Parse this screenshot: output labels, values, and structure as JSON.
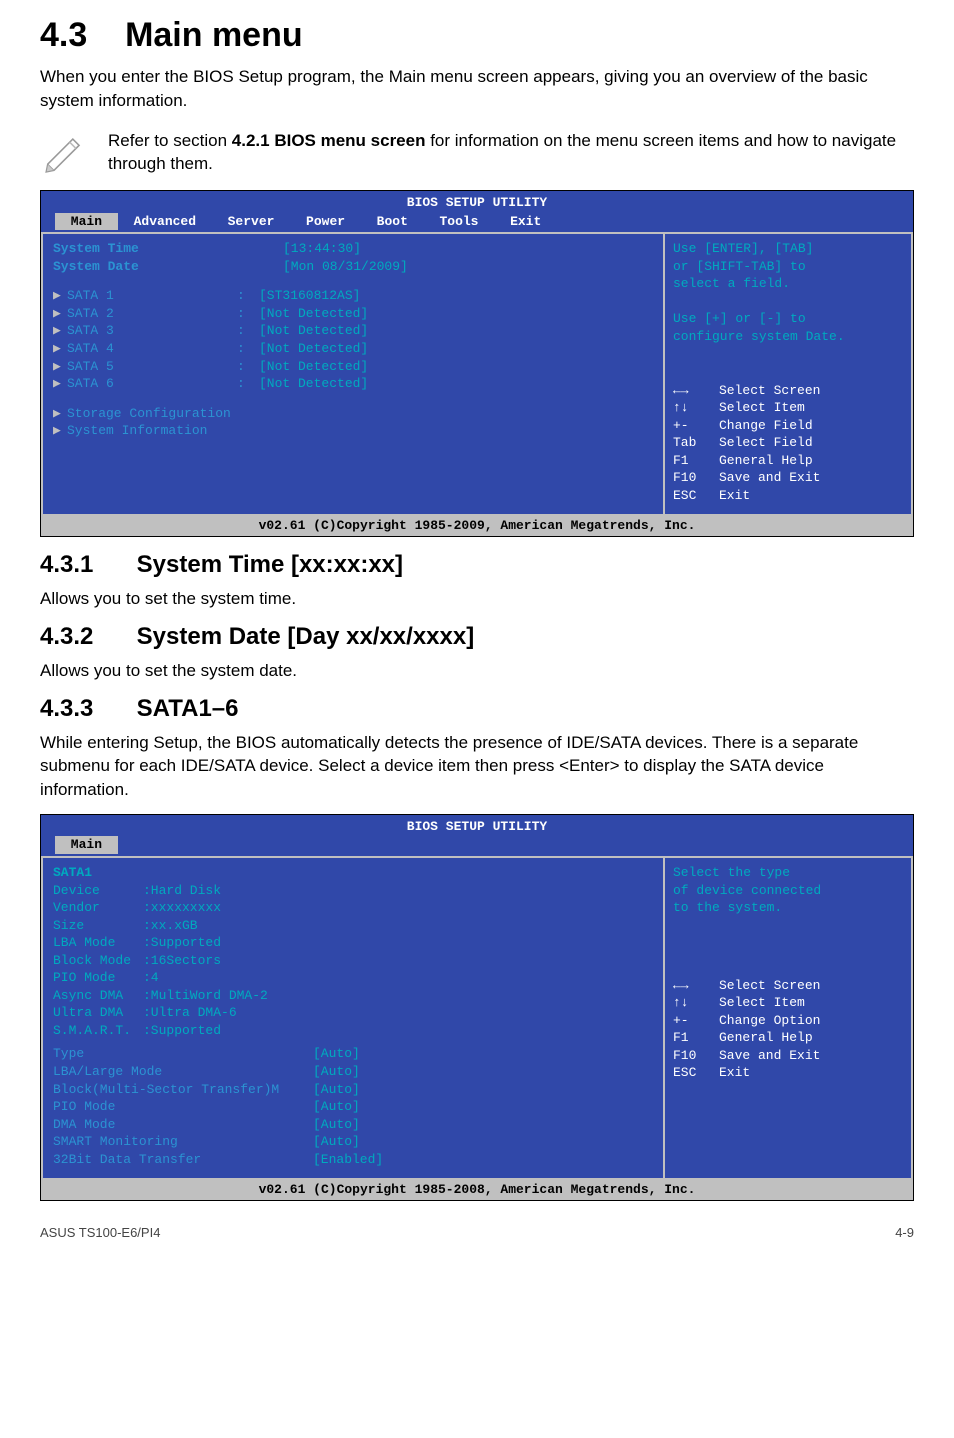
{
  "heading": {
    "num": "4.3",
    "title": "Main menu"
  },
  "intro": "When you enter the BIOS Setup program, the Main menu screen appears, giving you an overview of the basic system information.",
  "note": {
    "prefix": "Refer to section ",
    "bold": "4.2.1 BIOS menu screen",
    "suffix": " for information on the menu screen items and how to navigate through them."
  },
  "bios1": {
    "title": "BIOS SETUP UTILITY",
    "tabs": [
      "Main",
      "Advanced",
      "Server",
      "Power",
      "Boot",
      "Tools",
      "Exit"
    ],
    "active_tab": 0,
    "rows_top": [
      {
        "label": "System Time",
        "value": "[13:44:30]"
      },
      {
        "label": "System Date",
        "value": "[Mon 08/31/2009]"
      }
    ],
    "sata": [
      {
        "label": "SATA 1",
        "value": "[ST3160812AS]"
      },
      {
        "label": "SATA 2",
        "value": "[Not Detected]"
      },
      {
        "label": "SATA 3",
        "value": "[Not Detected]"
      },
      {
        "label": "SATA 4",
        "value": "[Not Detected]"
      },
      {
        "label": "SATA 5",
        "value": "[Not Detected]"
      },
      {
        "label": "SATA 6",
        "value": "[Not Detected]"
      }
    ],
    "menus": [
      "Storage Configuration",
      "System Information"
    ],
    "right_help": [
      "Use [ENTER], [TAB]",
      "or [SHIFT-TAB] to",
      "select a field.",
      "",
      "Use [+] or [-] to",
      "configure system Date."
    ],
    "legend": [
      {
        "k": "←→",
        "v": "Select Screen"
      },
      {
        "k": "↑↓",
        "v": "Select Item"
      },
      {
        "k": "+-",
        "v": "Change Field"
      },
      {
        "k": "Tab",
        "v": "Select Field"
      },
      {
        "k": "F1",
        "v": "General Help"
      },
      {
        "k": "F10",
        "v": "Save and Exit"
      },
      {
        "k": "ESC",
        "v": "Exit"
      }
    ],
    "footer": "v02.61 (C)Copyright 1985-2009, American Megatrends, Inc."
  },
  "sections": [
    {
      "num": "4.3.1",
      "title": "System Time [xx:xx:xx]",
      "body": "Allows you to set the system time."
    },
    {
      "num": "4.3.2",
      "title": "System Date [Day xx/xx/xxxx]",
      "body": "Allows you to set the system date."
    },
    {
      "num": "4.3.3",
      "title": "SATA1–6",
      "body": "While entering Setup, the BIOS automatically detects the presence of IDE/SATA devices. There is a separate submenu for each IDE/SATA device. Select a device item then press <Enter> to display the SATA device information."
    }
  ],
  "bios2": {
    "title": "BIOS SETUP UTILITY",
    "tabs": [
      "Main"
    ],
    "active_tab": 0,
    "right_help": [
      "Select the type",
      "of device connected",
      "to the system."
    ],
    "header": "SATA1",
    "info": [
      {
        "label": "Device",
        "value": ":Hard Disk"
      },
      {
        "label": "Vendor",
        "value": ":xxxxxxxxx"
      },
      {
        "label": "Size",
        "value": ":xx.xGB"
      },
      {
        "label": "LBA Mode",
        "value": ":Supported"
      },
      {
        "label": "Block Mode",
        "value": ":16Sectors"
      },
      {
        "label": "PIO Mode",
        "value": ":4"
      },
      {
        "label": "Async DMA",
        "value": ":MultiWord DMA-2"
      },
      {
        "label": "Ultra DMA",
        "value": ":Ultra DMA-6"
      },
      {
        "label": "S.M.A.R.T.",
        "value": ":Supported"
      }
    ],
    "settings": [
      {
        "label": "Type",
        "value": "[Auto]"
      },
      {
        "label": "LBA/Large Mode",
        "value": "[Auto]"
      },
      {
        "label": "Block(Multi-Sector Transfer)M",
        "value": "[Auto]"
      },
      {
        "label": "PIO Mode",
        "value": "[Auto]"
      },
      {
        "label": "DMA Mode",
        "value": "[Auto]"
      },
      {
        "label": "SMART Monitoring",
        "value": "[Auto]"
      },
      {
        "label": "32Bit Data Transfer",
        "value": "[Enabled]"
      }
    ],
    "legend": [
      {
        "k": "←→",
        "v": "Select Screen"
      },
      {
        "k": "↑↓",
        "v": "Select Item"
      },
      {
        "k": "+-",
        "v": "Change Option"
      },
      {
        "k": "F1",
        "v": "General Help"
      },
      {
        "k": "F10",
        "v": "Save and Exit"
      },
      {
        "k": "ESC",
        "v": "Exit"
      }
    ],
    "footer": "v02.61 (C)Copyright 1985-2008, American Megatrends, Inc."
  },
  "footer": {
    "left": "ASUS TS100-E6/PI4",
    "right": "4-9"
  }
}
